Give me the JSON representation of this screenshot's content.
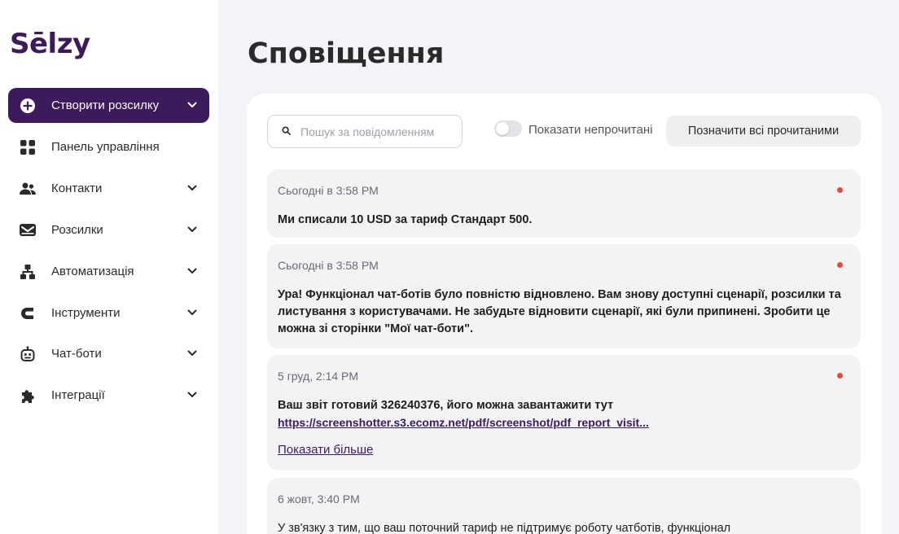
{
  "brand": {
    "logo_text": "Sēlzy"
  },
  "sidebar": {
    "items": [
      {
        "label": "Створити розсилку",
        "icon": "plus-circle-icon",
        "has_chevron": true,
        "active": true
      },
      {
        "label": "Панель управління",
        "icon": "dashboard-grid-icon",
        "has_chevron": false
      },
      {
        "label": "Контакти",
        "icon": "contacts-icon",
        "has_chevron": true
      },
      {
        "label": "Розсилки",
        "icon": "mail-icon",
        "has_chevron": true
      },
      {
        "label": "Автоматизація",
        "icon": "automation-icon",
        "has_chevron": true
      },
      {
        "label": "Інструменти",
        "icon": "tools-icon",
        "has_chevron": true
      },
      {
        "label": "Чат-боти",
        "icon": "chatbot-icon",
        "has_chevron": true
      },
      {
        "label": "Інтеграції",
        "icon": "puzzle-icon",
        "has_chevron": true
      }
    ]
  },
  "main": {
    "title": "Сповіщення",
    "search": {
      "placeholder": "Пошук за повідомленням",
      "value": ""
    },
    "toggle": {
      "label": "Показати непрочитані",
      "on": false
    },
    "mark_all_label": "Позначити всі прочитаними",
    "notifications": [
      {
        "date": "Сьогодні в 3:58 PM",
        "unread": true,
        "message": "Ми списали 10 USD за тариф Стандарт 500."
      },
      {
        "date": "Сьогодні в 3:58 PM",
        "unread": true,
        "message": "Ура! Функціонал чат-ботів було повністю відновлено. Вам знову доступні сценарії, розсилки та листування з користувачами. Не забудьте відновити сценарії, які були припинені. Зробити це можна зі сторінки \"Мої чат-боти\"."
      },
      {
        "date": "5 груд, 2:14 PM",
        "unread": true,
        "message": "Ваш звіт готовий 326240376, його можна завантажити тут",
        "link": "https://screenshotter.s3.ecomz.net/pdf/screenshot/pdf_report_visit...",
        "more_label": "Показати більше"
      },
      {
        "date": "6 жовт, 3:40 PM",
        "unread": false,
        "message": "У зв'язку з тим, що ваш поточний тариф не підтримує роботу чатботів, функціонал"
      }
    ]
  },
  "colors": {
    "brand": "#3d1a5c",
    "unread_dot": "#e54b3c",
    "page_bg": "#f3f4f8",
    "notification_bg": "#f3f3f5"
  }
}
